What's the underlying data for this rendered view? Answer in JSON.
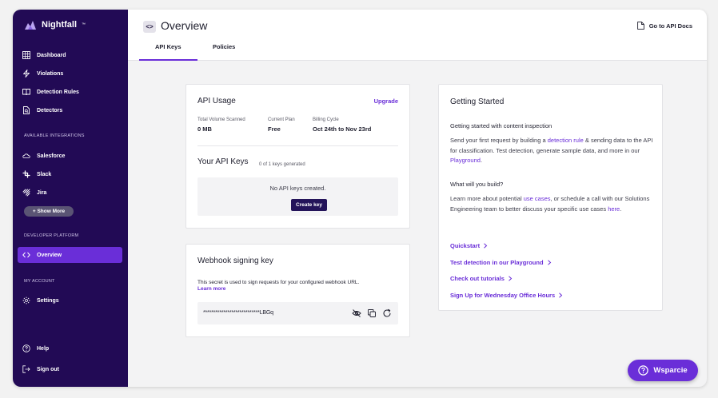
{
  "brand": {
    "name": "Nightfall",
    "tm": "™"
  },
  "sidebar": {
    "nav": [
      {
        "label": "Dashboard"
      },
      {
        "label": "Violations"
      },
      {
        "label": "Detection Rules"
      },
      {
        "label": "Detectors"
      }
    ],
    "integrations_label": "AVAILABLE INTEGRATIONS",
    "integrations": [
      {
        "label": "Salesforce"
      },
      {
        "label": "Slack"
      },
      {
        "label": "Jira"
      }
    ],
    "show_more": "+ Show More",
    "dev_label": "DEVELOPER PLATFORM",
    "overview": "Overview",
    "account_label": "MY ACCOUNT",
    "settings": "Settings",
    "help": "Help",
    "sign_out": "Sign out"
  },
  "header": {
    "icon_text": "<>",
    "title": "Overview",
    "docs_link": "Go to API Docs",
    "tabs": [
      {
        "label": "API Keys"
      },
      {
        "label": "Policies"
      }
    ]
  },
  "api_usage": {
    "title": "API Usage",
    "upgrade": "Upgrade",
    "stats": [
      {
        "label": "Total Volume Scanned",
        "value": "0 MB"
      },
      {
        "label": "Current Plan",
        "value": "Free"
      },
      {
        "label": "Billing Cycle",
        "value": "Oct 24th to Nov 23rd"
      }
    ],
    "keys_title": "Your API Keys",
    "keys_count": "0 of 1 keys generated",
    "empty_text": "No API keys created.",
    "create_key": "Create key"
  },
  "webhook": {
    "title": "Webhook signing key",
    "description": "This secret is used to sign requests for your configured webhook URL.",
    "learn_more": "Learn more",
    "secret": "****************************LBGq"
  },
  "getting_started": {
    "title": "Getting Started",
    "subtitle": "Getting started with content inspection",
    "p1_a": "Send your first request by building a ",
    "p1_link": "detection rule",
    "p1_b": " & sending data to the API for classification. Test detection, generate sample data, and more in our ",
    "p1_link2": "Playground",
    "p1_c": ".",
    "what_build": "What will you build?",
    "p2_a": "Learn more about potential ",
    "p2_link": "use cases",
    "p2_b": ", or schedule a call with our Solutions Engineering team to better discuss your specific use cases ",
    "p2_link2": "here",
    "p2_c": ".",
    "links": [
      {
        "label": "Quickstart"
      },
      {
        "label": "Test detection in our Playground"
      },
      {
        "label": "Check out tutorials"
      },
      {
        "label": "Sign Up for Wednesday Office Hours"
      }
    ]
  },
  "support": {
    "label": "Wsparcie"
  },
  "colors": {
    "sidebar": "#220a55",
    "accent": "#6a2ed8",
    "button_dark": "#24145a"
  }
}
